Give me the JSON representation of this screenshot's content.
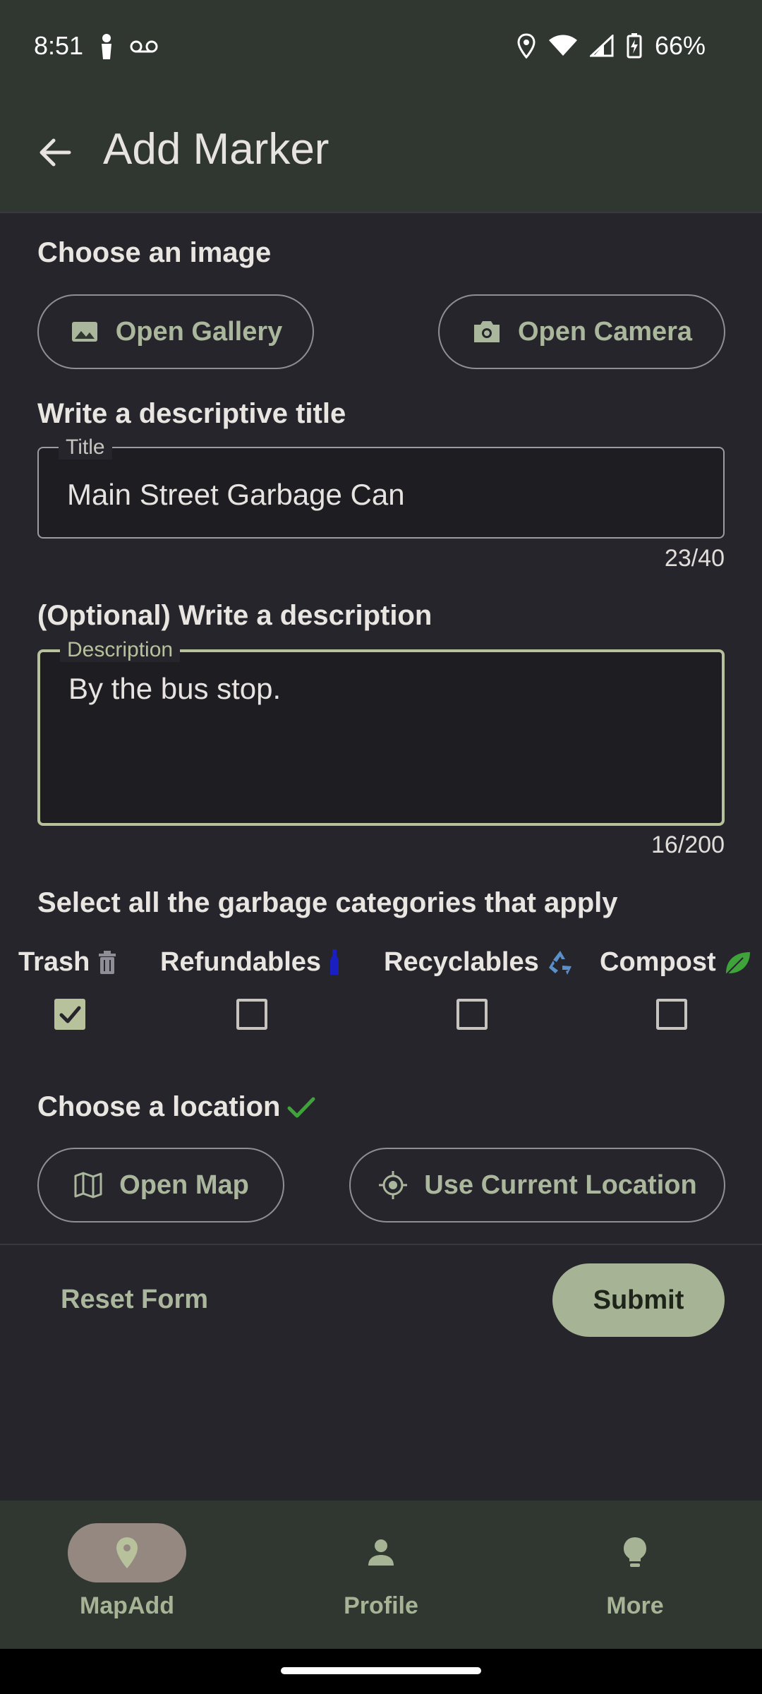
{
  "status_bar": {
    "time": "8:51",
    "battery": "66%",
    "icons": [
      "lock-person-icon",
      "voicemail-icon",
      "location-icon",
      "wifi-icon",
      "signal-icon",
      "battery-charging-icon"
    ]
  },
  "app_bar": {
    "title": "Add Marker",
    "back_icon": "arrow-left-icon"
  },
  "image_section": {
    "heading": "Choose an image",
    "gallery_label": "Open Gallery",
    "camera_label": "Open Camera"
  },
  "title_section": {
    "heading": "Write a descriptive title",
    "field_label": "Title",
    "value": "Main Street Garbage Can",
    "counter": "23/40"
  },
  "description_section": {
    "heading": "(Optional) Write a description",
    "field_label": "Description",
    "value": "By the bus stop.",
    "counter": "16/200"
  },
  "categories_section": {
    "heading": "Select all the garbage categories that apply",
    "items": [
      {
        "label": "Trash",
        "icon": "trash-icon",
        "checked": true
      },
      {
        "label": "Refundables",
        "icon": "bottle-icon",
        "checked": false
      },
      {
        "label": "Recyclables",
        "icon": "recycle-icon",
        "checked": false
      },
      {
        "label": "Compost",
        "icon": "leaf-icon",
        "checked": false
      }
    ]
  },
  "location_section": {
    "heading": "Choose a location",
    "map_label": "Open Map",
    "current_location_label": "Use Current Location"
  },
  "actions": {
    "reset_label": "Reset Form",
    "submit_label": "Submit"
  },
  "bottom_nav": {
    "items": [
      {
        "label": "MapAdd",
        "icon": "map-pin-icon",
        "active": true
      },
      {
        "label": "Profile",
        "icon": "person-icon",
        "active": false
      },
      {
        "label": "More",
        "icon": "lightbulb-icon",
        "active": false
      }
    ]
  },
  "colors": {
    "background": "#26252c",
    "app_bar": "#303630",
    "accent": "#aab79d",
    "submit": "#a6b394",
    "active_nav": "#948881"
  }
}
